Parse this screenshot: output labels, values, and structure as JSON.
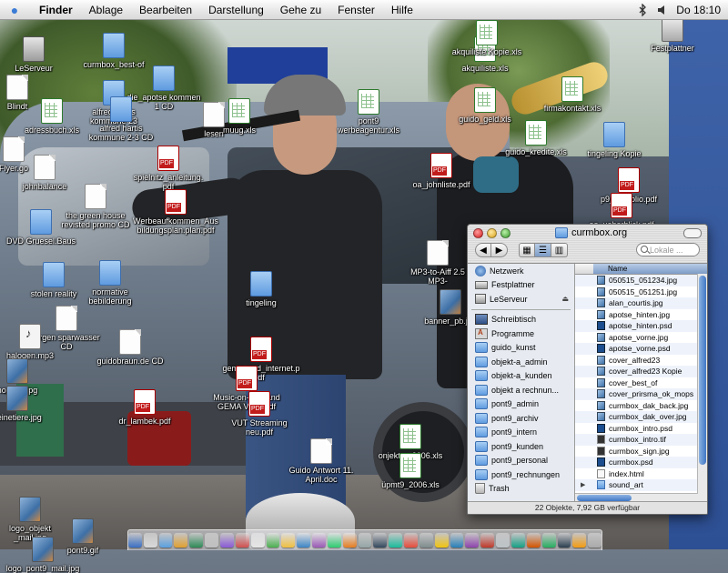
{
  "menubar": {
    "app": "Finder",
    "items": [
      "Ablage",
      "Bearbeiten",
      "Darstellung",
      "Gehe zu",
      "Fenster",
      "Hilfe"
    ],
    "clock": "Do 18:10"
  },
  "desktop_icons": [
    {
      "label": "LeServeur",
      "type": "srv"
    },
    {
      "label": "curmbox_best-of",
      "type": "folder"
    },
    {
      "label": "die_apotse kommen\n1 CD",
      "type": "folder"
    },
    {
      "label": "akquiliste.xls",
      "type": "xls"
    },
    {
      "label": "akquiliste Kopie.xls",
      "type": "xls"
    },
    {
      "label": "Festplattner",
      "type": "disk"
    },
    {
      "label": "Blindt",
      "type": "doc"
    },
    {
      "label": "alfred-hartis\nkommune 23",
      "type": "folder"
    },
    {
      "label": "adressbuch.xls",
      "type": "xls"
    },
    {
      "label": "alfred hartis\nkommune 2-3 CD",
      "type": "folder"
    },
    {
      "label": "lesen",
      "type": "doc"
    },
    {
      "label": "muug.xls",
      "type": "xls"
    },
    {
      "label": "pont9\nwerbeagentur.xls",
      "type": "xls"
    },
    {
      "label": "guido_geld.xls",
      "type": "xls"
    },
    {
      "label": "firmakontakt.xls",
      "type": "xls"
    },
    {
      "label": "guido_kredite.xls",
      "type": "xls"
    },
    {
      "label": "tingeling Kopie",
      "type": "folder"
    },
    {
      "label": "Flyer.go",
      "type": "doc"
    },
    {
      "label": "johnbalance",
      "type": "doc"
    },
    {
      "label": "spielnitz_anleitung.\npdf",
      "type": "pdf"
    },
    {
      "label": "oa_johnliste.pdf",
      "type": "pdf"
    },
    {
      "label": "p9_portfolio.pdf",
      "type": "pdf"
    },
    {
      "label": "the green house\nrevisted promo CD",
      "type": "doc"
    },
    {
      "label": "Werbeaufkommen_Aus\nbildungsplan.plan.pdf",
      "type": "pdf"
    },
    {
      "label": "oa_ueberblick.pdf",
      "type": "pdf"
    },
    {
      "label": "DVD Gruesel.Baus",
      "type": "folder"
    },
    {
      "label": "MP3-to-Aiff 2.5\nMP3-",
      "type": "doc"
    },
    {
      "label": "stolen reality",
      "type": "folder"
    },
    {
      "label": "normative\nbebilderung",
      "type": "folder"
    },
    {
      "label": "tingeling",
      "type": "folder"
    },
    {
      "label": "banner_pb.jpg",
      "type": "img"
    },
    {
      "label": "jorgen sparwasser\nCD",
      "type": "doc"
    },
    {
      "label": "halogen.mp3",
      "type": "audio"
    },
    {
      "label": "guidobraun.de CD",
      "type": "doc"
    },
    {
      "label": "gema_und_internet.p\ndf",
      "type": "pdf"
    },
    {
      "label": "noppen.jpg",
      "type": "img"
    },
    {
      "label": "Music-on-Demand\nGEMA Ve... .pdf",
      "type": "pdf"
    },
    {
      "label": "seinetiere.jpg",
      "type": "img"
    },
    {
      "label": "dr_lambek.pdf",
      "type": "pdf"
    },
    {
      "label": "VUT Streaming\nneu.pdf",
      "type": "pdf"
    },
    {
      "label": "onjekt-a_2006.xls",
      "type": "xls"
    },
    {
      "label": "Guido Antwort 11.\nApril.doc",
      "type": "doc"
    },
    {
      "label": "üpmt9_2006.xls",
      "type": "xls"
    },
    {
      "label": "logo_objekt\n_mail.jpg",
      "type": "img"
    },
    {
      "label": "pont9.gif",
      "type": "img"
    },
    {
      "label": "logo_pont9_mail.jpg",
      "type": "img"
    }
  ],
  "finder": {
    "title": "curmbox.org",
    "search_placeholder": "Lokale ...",
    "sidebar": [
      {
        "label": "Netzwerk",
        "icon": "network-icon"
      },
      {
        "label": "Festplattner",
        "icon": "hard-disk-icon"
      },
      {
        "label": "LeServeur",
        "icon": "server-icon",
        "eject": "⏏"
      },
      {
        "sep": true
      },
      {
        "label": "Schreibtisch",
        "icon": "desktop-icon"
      },
      {
        "label": "Programme",
        "icon": "applications-icon"
      },
      {
        "label": "guido_kunst",
        "icon": "folder-icon"
      },
      {
        "label": "objekt-a_admin",
        "icon": "folder-icon"
      },
      {
        "label": "objekt-a_kunden",
        "icon": "folder-icon"
      },
      {
        "label": "objekt a rechnun...",
        "icon": "folder-icon"
      },
      {
        "label": "pont9_admin",
        "icon": "folder-icon"
      },
      {
        "label": "pont9_archiv",
        "icon": "folder-icon"
      },
      {
        "label": "pont9_intern",
        "icon": "folder-icon"
      },
      {
        "label": "pont9_kunden",
        "icon": "folder-icon"
      },
      {
        "label": "pont9_personal",
        "icon": "folder-icon"
      },
      {
        "label": "pont9_rechnungen",
        "icon": "folder-icon"
      },
      {
        "label": "Trash",
        "icon": "trash-icon"
      }
    ],
    "column_header": "Name",
    "files": [
      {
        "name": "050515_051234.jpg",
        "kind": "jpg"
      },
      {
        "name": "050515_051251.jpg",
        "kind": "jpg"
      },
      {
        "name": "alan_courtis.jpg",
        "kind": "jpg"
      },
      {
        "name": "apotse_hinten.jpg",
        "kind": "jpg"
      },
      {
        "name": "apotse_hinten.psd",
        "kind": "psd"
      },
      {
        "name": "apotse_vorne.jpg",
        "kind": "jpg"
      },
      {
        "name": "apotse_vorne.psd",
        "kind": "psd"
      },
      {
        "name": "cover_alfred23",
        "kind": "jpg"
      },
      {
        "name": "cover_alfred23 Kopie",
        "kind": "jpg"
      },
      {
        "name": "cover_best_of",
        "kind": "jpg"
      },
      {
        "name": "cover_prirsma_ok_mops",
        "kind": "jpg"
      },
      {
        "name": "curmbox_dak_back.jpg",
        "kind": "jpg"
      },
      {
        "name": "curmbox_dak_over.jpg",
        "kind": "jpg"
      },
      {
        "name": "curmbox_intro.psd",
        "kind": "psd"
      },
      {
        "name": "curmbox_intro.tif",
        "kind": "tif"
      },
      {
        "name": "curmbox_sign.jpg",
        "kind": "tif"
      },
      {
        "name": "curmbox.psd",
        "kind": "psd"
      },
      {
        "name": "index.html",
        "kind": "html"
      },
      {
        "name": "sound_art",
        "kind": "folder",
        "disclosure": "▶"
      }
    ],
    "status": "22 Objekte, 7,92 GB verfügbar"
  },
  "dock": {
    "colors": [
      "#3a6fc4",
      "#d9d9d9",
      "#5aa0e0",
      "#e0a030",
      "#2e8b57",
      "#c0c0c0",
      "#8a5ad6",
      "#d05050",
      "#e6e6e6",
      "#4caf50",
      "#f0c040",
      "#3d85c6",
      "#9b59b6",
      "#2ecc71",
      "#e67e22",
      "#95a5a6",
      "#34495e",
      "#1abc9c",
      "#e74c3c",
      "#7f8c8d",
      "#f1c40f",
      "#2980b9",
      "#8e44ad",
      "#c0392b",
      "#bdc3c7",
      "#16a085",
      "#d35400",
      "#27ae60",
      "#2c3e50",
      "#f39c12",
      "#aaaaaa"
    ]
  }
}
